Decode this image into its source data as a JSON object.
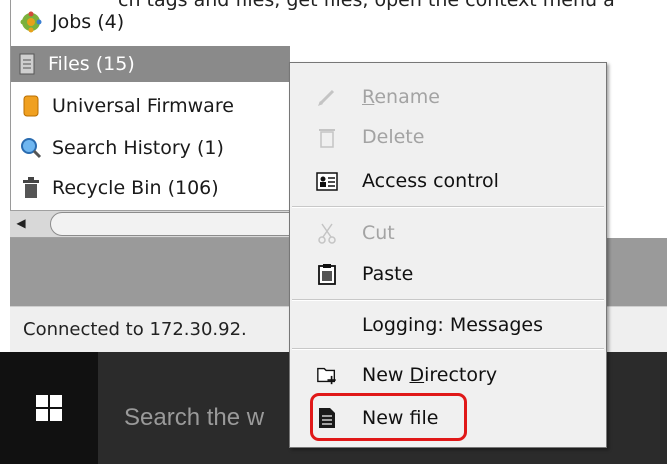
{
  "top_cut_text": "ch tags and files, get files, open the context menu a",
  "tree": {
    "items": [
      {
        "label": "Jobs (4)",
        "icon": "gear-icon"
      },
      {
        "label": "Files (15)",
        "icon": "file-icon",
        "selected": true
      },
      {
        "label": "Universal Firmware",
        "icon": "firmware-icon"
      },
      {
        "label": "Search History (1)",
        "icon": "magnifier-icon"
      },
      {
        "label": "Recycle Bin (106)",
        "icon": "trash-icon"
      }
    ]
  },
  "status_text": "Connected to 172.30.92.",
  "taskbar": {
    "search_text": "Search the w"
  },
  "context_menu": {
    "rename": {
      "prefix": "",
      "mnemonic": "R",
      "rest": "ename",
      "enabled": false
    },
    "delete": {
      "label": "Delete",
      "enabled": false
    },
    "access_control": {
      "label": "Access control",
      "enabled": true
    },
    "cut": {
      "label": "Cut",
      "enabled": false
    },
    "paste": {
      "label": "Paste",
      "enabled": true
    },
    "logging": {
      "label": "Logging: Messages",
      "enabled": true
    },
    "new_directory": {
      "prefix": "New ",
      "mnemonic": "D",
      "rest": "irectory",
      "enabled": true
    },
    "new_file": {
      "label": "New file",
      "enabled": true,
      "highlighted": true
    }
  },
  "colors": {
    "highlight_border": "#e01818",
    "selected_row": "#8a8a8a",
    "taskbar": "#2b2b2b"
  }
}
